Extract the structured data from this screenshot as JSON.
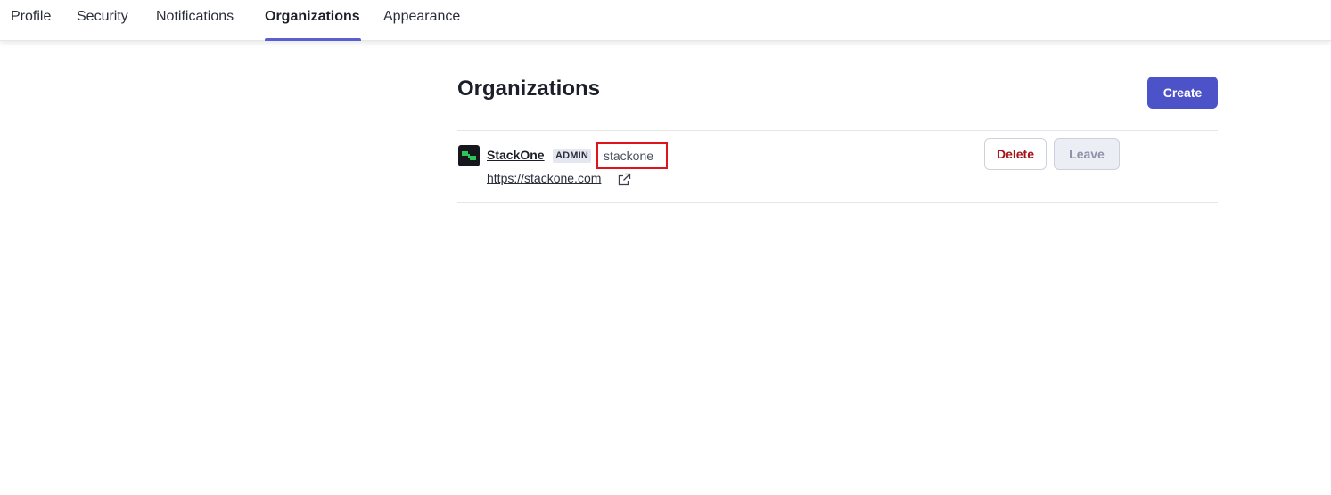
{
  "nav": {
    "tabs": [
      {
        "label": "Profile"
      },
      {
        "label": "Security"
      },
      {
        "label": "Notifications"
      },
      {
        "label": "Organizations",
        "active": true
      },
      {
        "label": "Appearance"
      }
    ]
  },
  "page": {
    "title": "Organizations",
    "create_label": "Create"
  },
  "organizations": [
    {
      "name": "StackOne",
      "role": "ADMIN",
      "slug": "stackone",
      "url": "https://stackone.com",
      "logo_icon": "stackone-logo-icon",
      "delete_label": "Delete",
      "leave_label": "Leave",
      "leave_disabled": true
    }
  ],
  "colors": {
    "accent": "#4c52c8",
    "active_tab_underline": "#5a5fcf",
    "danger_text": "#a3141a",
    "highlight_box": "#e0121c",
    "logo_green": "#2fc45a"
  }
}
